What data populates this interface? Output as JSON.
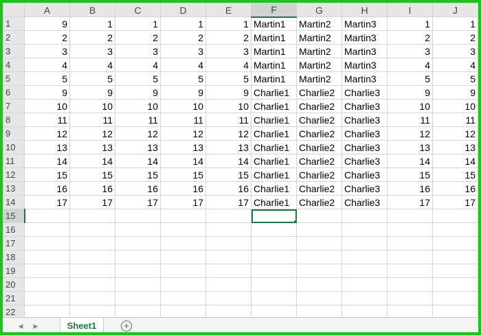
{
  "columns": [
    "A",
    "B",
    "C",
    "D",
    "E",
    "F",
    "G",
    "H",
    "I",
    "J"
  ],
  "row_numbers": [
    "1",
    "2",
    "3",
    "4",
    "5",
    "6",
    "7",
    "8",
    "9",
    "10",
    "11",
    "12",
    "13",
    "14",
    "15",
    "16",
    "17",
    "18",
    "19",
    "20",
    "21",
    "22"
  ],
  "rows": [
    [
      "9",
      "1",
      "1",
      "1",
      "1",
      "Martin1",
      "Martin2",
      "Martin3",
      "1",
      "1"
    ],
    [
      "2",
      "2",
      "2",
      "2",
      "2",
      "Martin1",
      "Martin2",
      "Martin3",
      "2",
      "2"
    ],
    [
      "3",
      "3",
      "3",
      "3",
      "3",
      "Martin1",
      "Martin2",
      "Martin3",
      "3",
      "3"
    ],
    [
      "4",
      "4",
      "4",
      "4",
      "4",
      "Martin1",
      "Martin2",
      "Martin3",
      "4",
      "4"
    ],
    [
      "5",
      "5",
      "5",
      "5",
      "5",
      "Martin1",
      "Martin2",
      "Martin3",
      "5",
      "5"
    ],
    [
      "9",
      "9",
      "9",
      "9",
      "9",
      "Charlie1",
      "Charlie2",
      "Charlie3",
      "9",
      "9"
    ],
    [
      "10",
      "10",
      "10",
      "10",
      "10",
      "Charlie1",
      "Charlie2",
      "Charlie3",
      "10",
      "10"
    ],
    [
      "11",
      "11",
      "11",
      "11",
      "11",
      "Charlie1",
      "Charlie2",
      "Charlie3",
      "11",
      "11"
    ],
    [
      "12",
      "12",
      "12",
      "12",
      "12",
      "Charlie1",
      "Charlie2",
      "Charlie3",
      "12",
      "12"
    ],
    [
      "13",
      "13",
      "13",
      "13",
      "13",
      "Charlie1",
      "Charlie2",
      "Charlie3",
      "13",
      "13"
    ],
    [
      "14",
      "14",
      "14",
      "14",
      "14",
      "Charlie1",
      "Charlie2",
      "Charlie3",
      "14",
      "14"
    ],
    [
      "15",
      "15",
      "15",
      "15",
      "15",
      "Charlie1",
      "Charlie2",
      "Charlie3",
      "15",
      "15"
    ],
    [
      "16",
      "16",
      "16",
      "16",
      "16",
      "Charlie1",
      "Charlie2",
      "Charlie3",
      "16",
      "16"
    ],
    [
      "17",
      "17",
      "17",
      "17",
      "17",
      "Charlie1",
      "Charlie2",
      "Charlie3",
      "17",
      "17"
    ]
  ],
  "selected_cell": "F15",
  "tabs": {
    "prev_icon": "triangle-left-icon",
    "next_icon": "triangle-right-icon",
    "sheet_name": "Sheet1",
    "add_icon": "plus-circle-icon"
  },
  "colors": {
    "frame": "#1ec21e",
    "accent": "#217346"
  }
}
